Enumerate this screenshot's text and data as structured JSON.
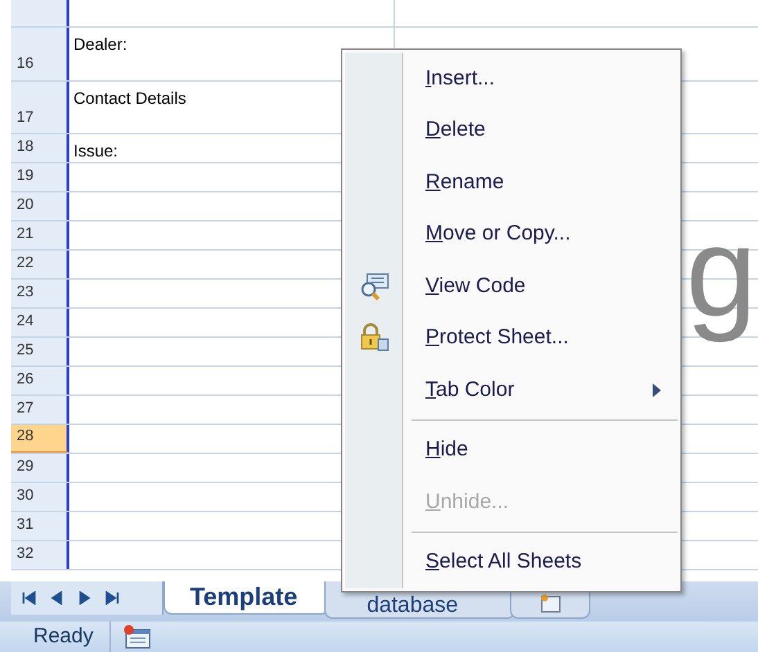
{
  "sheet": {
    "rows": [
      {
        "number": "16",
        "cell": "Dealer:",
        "tall": true,
        "selected": false
      },
      {
        "number": "17",
        "cell": "Contact Details",
        "tall": true,
        "selected": false
      },
      {
        "number": "18",
        "cell": "Issue:",
        "tall": false,
        "selected": false
      },
      {
        "number": "19",
        "tall": false,
        "selected": false
      },
      {
        "number": "20",
        "tall": false,
        "selected": false
      },
      {
        "number": "21",
        "tall": false,
        "selected": false
      },
      {
        "number": "22",
        "tall": false,
        "selected": false
      },
      {
        "number": "23",
        "tall": false,
        "selected": false
      },
      {
        "number": "24",
        "tall": false,
        "selected": false
      },
      {
        "number": "25",
        "tall": false,
        "selected": false
      },
      {
        "number": "26",
        "tall": false,
        "selected": false
      },
      {
        "number": "27",
        "tall": false,
        "selected": false
      },
      {
        "number": "28",
        "tall": false,
        "selected": true
      },
      {
        "number": "29",
        "tall": false,
        "selected": false
      },
      {
        "number": "30",
        "tall": false,
        "selected": false
      },
      {
        "number": "31",
        "tall": false,
        "selected": false
      },
      {
        "number": "32",
        "tall": false,
        "selected": false
      }
    ],
    "large_text": "g"
  },
  "context_menu": {
    "items": [
      {
        "kind": "item",
        "label": "Insert...",
        "disabled": false,
        "submenu": false
      },
      {
        "kind": "item",
        "label": "Delete",
        "disabled": false,
        "submenu": false
      },
      {
        "kind": "item",
        "label": "Rename",
        "disabled": false,
        "submenu": false
      },
      {
        "kind": "item",
        "label": "Move or Copy...",
        "disabled": false,
        "submenu": false
      },
      {
        "kind": "item",
        "label": "View Code",
        "disabled": false,
        "submenu": false
      },
      {
        "kind": "item",
        "label": "Protect Sheet...",
        "disabled": false,
        "submenu": false
      },
      {
        "kind": "item",
        "label": "Tab Color",
        "disabled": false,
        "submenu": true
      },
      {
        "kind": "separator"
      },
      {
        "kind": "item",
        "label": "Hide",
        "disabled": false,
        "submenu": false
      },
      {
        "kind": "item",
        "label": "Unhide...",
        "disabled": true,
        "submenu": false
      },
      {
        "kind": "separator"
      },
      {
        "kind": "item",
        "label": "Select All Sheets",
        "disabled": false,
        "submenu": false
      }
    ]
  },
  "sheet_tabs": [
    {
      "label": "Template",
      "selected": true
    },
    {
      "label": "database",
      "selected": false
    }
  ],
  "status_bar": {
    "text": "Ready"
  }
}
